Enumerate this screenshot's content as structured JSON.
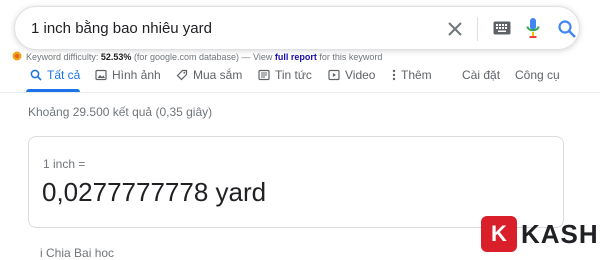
{
  "search": {
    "query": "1 inch bằng bao nhiêu yard"
  },
  "keyword_bar": {
    "label": "Keyword difficulty:",
    "value": "52.53%",
    "database": "(for google.com database) — View",
    "link": "full report",
    "suffix": "for this keyword"
  },
  "tabs": {
    "all": "Tất cả",
    "images": "Hình ảnh",
    "shopping": "Mua sắm",
    "news": "Tin tức",
    "video": "Video",
    "more": "Thêm",
    "settings": "Cài đặt",
    "tools": "Công cụ"
  },
  "results": {
    "stats": "Khoảng 29.500 kết quả (0,35 giây)"
  },
  "converter": {
    "input": "1 inch =",
    "output": "0,0277777778 yard"
  },
  "next_result": {
    "text": "i                 Chia Bai hoc"
  },
  "watermark": {
    "letter": "K",
    "text": "KASHI"
  },
  "colors": {
    "accent": "#1a73e8",
    "brand_red": "#d81f2a"
  }
}
